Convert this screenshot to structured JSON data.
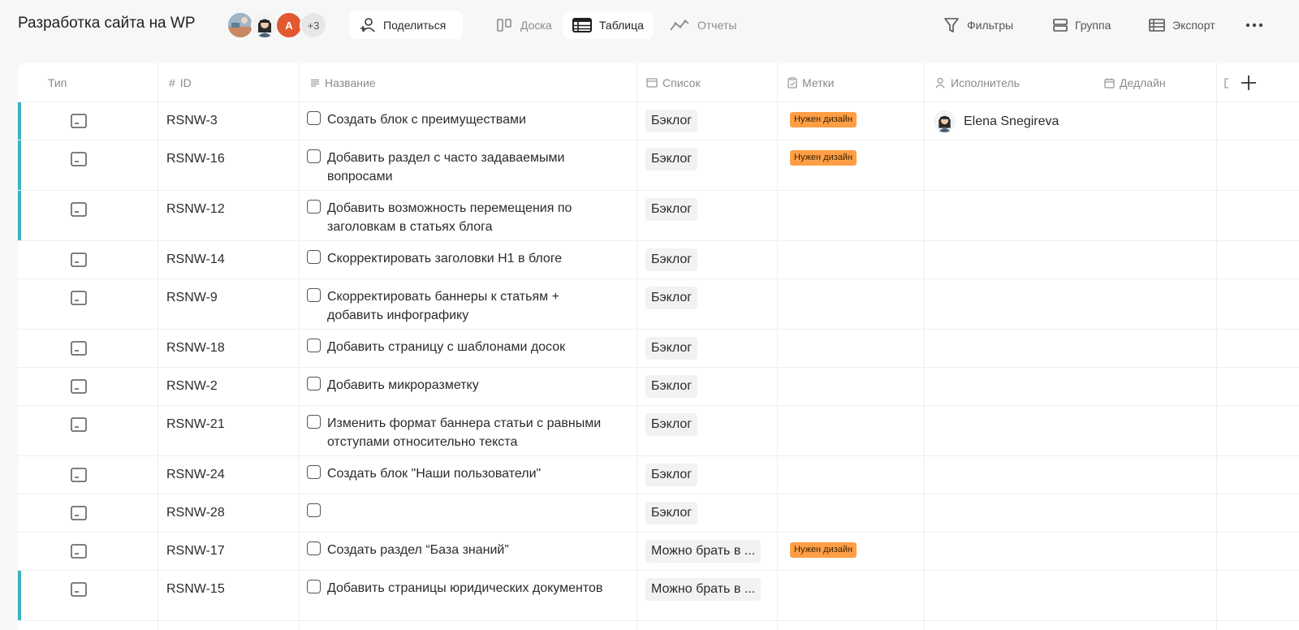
{
  "header": {
    "project_title": "Разработка сайта на WP",
    "avatars": [
      {
        "type": "photo",
        "icon": "landscape-photo"
      },
      {
        "type": "photo",
        "icon": "woman-photo"
      },
      {
        "type": "letter",
        "label": "А",
        "color": "#e2592f"
      },
      {
        "type": "more",
        "label": "+3"
      }
    ],
    "share_label": "Поделиться",
    "views": [
      {
        "label": "Доска",
        "icon": "board-icon",
        "active": false
      },
      {
        "label": "Таблица",
        "icon": "table-icon",
        "active": true
      },
      {
        "label": "Отчеты",
        "icon": "chart-icon",
        "active": false
      }
    ],
    "tools": {
      "filters": "Фильтры",
      "group": "Группа",
      "export": "Экспорт"
    }
  },
  "columns": {
    "type": "Тип",
    "id": "ID",
    "name": "Название",
    "list": "Список",
    "tags": "Метки",
    "assignee": "Исполнитель",
    "deadline": "Дедлайн"
  },
  "colors": {
    "accent": "#3cb4c0",
    "tag": "#ff9e45"
  },
  "rows": [
    {
      "id": "RSNW-3",
      "name": "Создать блок с преимуществами",
      "list": "Бэклог",
      "tag": "Нужен дизайн",
      "assignee": "Elena Snegireva",
      "accent": true
    },
    {
      "id": "RSNW-16",
      "name": "Добавить раздел с часто задаваемыми вопросами",
      "list": "Бэклог",
      "tag": "Нужен дизайн",
      "assignee": "",
      "accent": true
    },
    {
      "id": "RSNW-12",
      "name": "Добавить возможность перемещения по заголовкам в статьях блога",
      "list": "Бэклог",
      "tag": "",
      "assignee": "",
      "accent": true
    },
    {
      "id": "RSNW-14",
      "name": "Скорректировать заголовки H1 в блоге",
      "list": "Бэклог",
      "tag": "",
      "assignee": "",
      "accent": false
    },
    {
      "id": "RSNW-9",
      "name": "Скорректировать баннеры к статьям + добавить инфографику",
      "list": "Бэклог",
      "tag": "",
      "assignee": "",
      "accent": false
    },
    {
      "id": "RSNW-18",
      "name": "Добавить страницу с шаблонами досок",
      "list": "Бэклог",
      "tag": "",
      "assignee": "",
      "accent": false
    },
    {
      "id": "RSNW-2",
      "name": "Добавить микроразметку",
      "list": "Бэклог",
      "tag": "",
      "assignee": "",
      "accent": false
    },
    {
      "id": "RSNW-21",
      "name": "Изменить формат баннера статьи с равными отступами относительно текста",
      "list": "Бэклог",
      "tag": "",
      "assignee": "",
      "accent": false
    },
    {
      "id": "RSNW-24",
      "name": "Создать блок \"Наши пользователи\"",
      "list": "Бэклог",
      "tag": "",
      "assignee": "",
      "accent": false
    },
    {
      "id": "RSNW-28",
      "name": "",
      "list": "Бэклог",
      "tag": "",
      "assignee": "",
      "accent": false
    },
    {
      "id": "RSNW-17",
      "name": "Создать раздел “База знаний”",
      "list": "Можно брать в ...",
      "tag": "Нужен дизайн",
      "assignee": "",
      "accent": false
    },
    {
      "id": "RSNW-15",
      "name": "Добавить страницы юридических документов",
      "list": "Можно брать в ...",
      "tag": "",
      "assignee": "",
      "accent": true
    }
  ]
}
